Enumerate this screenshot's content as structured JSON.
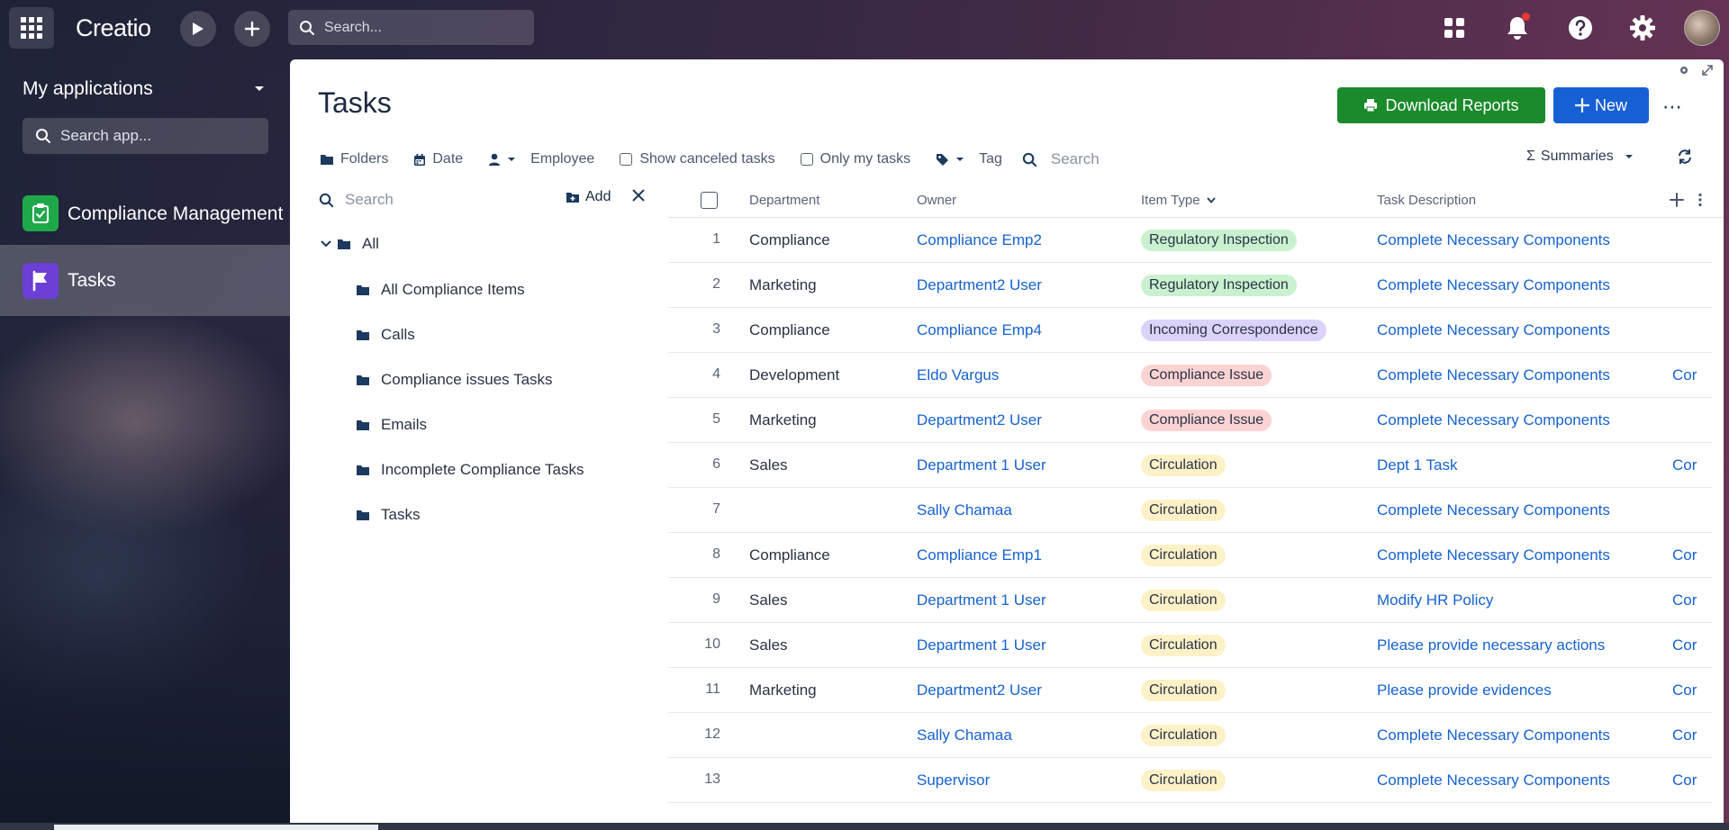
{
  "topbar": {
    "logo_text": "Creatio",
    "search_placeholder": "Search..."
  },
  "sidebar": {
    "heading": "My applications",
    "search_placeholder": "Search app...",
    "items": [
      {
        "label": "Compliance Management",
        "icon": "clipboard-icon",
        "color": "#1fa84a",
        "active": false
      },
      {
        "label": "Tasks",
        "icon": "flag-icon",
        "color": "#6c3fd6",
        "active": true
      }
    ]
  },
  "page": {
    "title": "Tasks",
    "download_label": "Download Reports",
    "new_label": "New"
  },
  "filters": {
    "folders": "Folders",
    "date": "Date",
    "employee": "Employee",
    "show_canceled": "Show canceled tasks",
    "only_my": "Only my tasks",
    "tag": "Tag",
    "search_placeholder": "Search",
    "summaries": "Summaries"
  },
  "folder_pane": {
    "search_placeholder": "Search",
    "add_label": "Add",
    "root": "All",
    "folders": [
      "All Compliance Items",
      "Calls",
      "Compliance issues Tasks",
      "Emails",
      "Incomplete Compliance Tasks",
      "Tasks"
    ]
  },
  "grid": {
    "columns": [
      "Department",
      "Owner",
      "Item Type",
      "Task Description"
    ],
    "rows": [
      {
        "n": "1",
        "dept": "Compliance",
        "owner": "Compliance Emp2",
        "type": "Regulatory Inspection",
        "desc": "Complete Necessary Components",
        "extra": ""
      },
      {
        "n": "2",
        "dept": "Marketing",
        "owner": "Department2 User",
        "type": "Regulatory Inspection",
        "desc": "Complete Necessary Components",
        "extra": ""
      },
      {
        "n": "3",
        "dept": "Compliance",
        "owner": "Compliance Emp4",
        "type": "Incoming Correspondence",
        "desc": "Complete Necessary Components",
        "extra": ""
      },
      {
        "n": "4",
        "dept": "Development",
        "owner": "Eldo Vargus",
        "type": "Compliance Issue",
        "desc": "Complete Necessary Components",
        "extra": "Cor"
      },
      {
        "n": "5",
        "dept": "Marketing",
        "owner": "Department2 User",
        "type": "Compliance Issue",
        "desc": "Complete Necessary Components",
        "extra": ""
      },
      {
        "n": "6",
        "dept": "Sales",
        "owner": "Department 1 User",
        "type": "Circulation",
        "desc": "Dept 1 Task",
        "extra": "Cor"
      },
      {
        "n": "7",
        "dept": "",
        "owner": "Sally Chamaa",
        "type": "Circulation",
        "desc": "Complete Necessary Components",
        "extra": ""
      },
      {
        "n": "8",
        "dept": "Compliance",
        "owner": "Compliance Emp1",
        "type": "Circulation",
        "desc": "Complete Necessary Components",
        "extra": "Cor"
      },
      {
        "n": "9",
        "dept": "Sales",
        "owner": "Department 1 User",
        "type": "Circulation",
        "desc": "Modify HR Policy",
        "extra": "Cor"
      },
      {
        "n": "10",
        "dept": "Sales",
        "owner": "Department 1 User",
        "type": "Circulation",
        "desc": "Please provide necessary actions",
        "extra": "Cor"
      },
      {
        "n": "11",
        "dept": "Marketing",
        "owner": "Department2 User",
        "type": "Circulation",
        "desc": "Please provide evidences",
        "extra": "Cor"
      },
      {
        "n": "12",
        "dept": "",
        "owner": "Sally Chamaa",
        "type": "Circulation",
        "desc": "Complete Necessary Components",
        "extra": "Cor"
      },
      {
        "n": "13",
        "dept": "",
        "owner": "Supervisor",
        "type": "Circulation",
        "desc": "Complete Necessary Components",
        "extra": "Cor"
      }
    ]
  },
  "chip_colors": {
    "Regulatory Inspection": "#c9f1cf",
    "Incoming Correspondence": "#dcd3fb",
    "Compliance Issue": "#fbd3d3",
    "Circulation": "#fdf1c7"
  }
}
